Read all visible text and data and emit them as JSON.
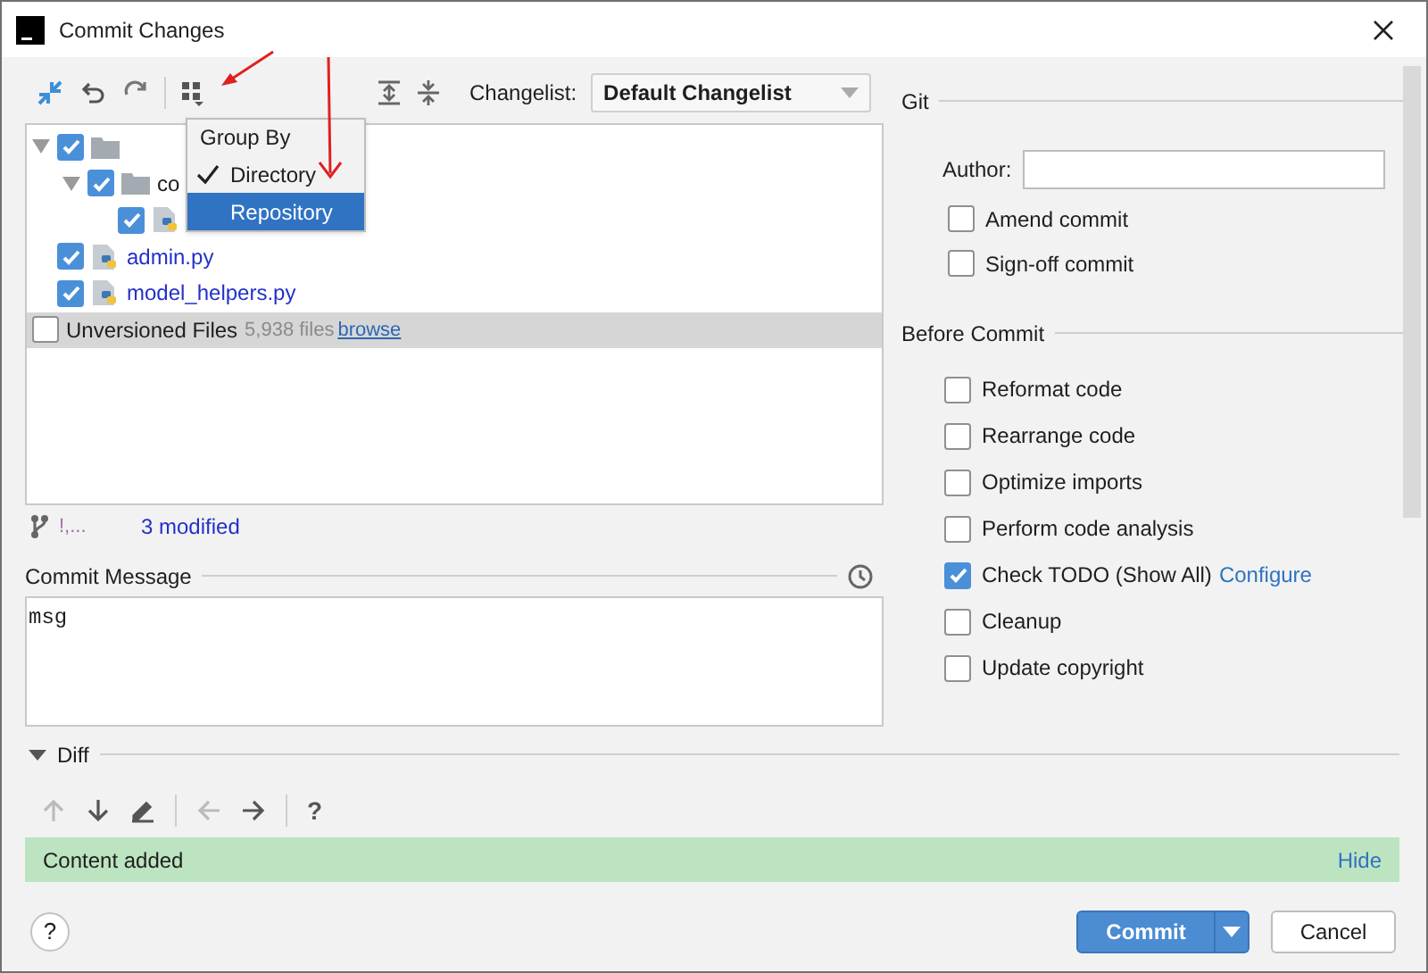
{
  "window": {
    "title": "Commit Changes"
  },
  "toolbar": {
    "changelist_label": "Changelist:",
    "changelist_value": "Default Changelist"
  },
  "group_by_menu": {
    "title": "Group By",
    "items": [
      {
        "label": "Directory",
        "checked": true,
        "selected": false
      },
      {
        "label": "Repository",
        "checked": false,
        "selected": true
      }
    ]
  },
  "tree": [
    {
      "kind": "folder",
      "checked": true,
      "expanded": true,
      "children": [
        {
          "kind": "folder",
          "label": "co",
          "checked": true,
          "expanded": true,
          "children": [
            {
              "kind": "file",
              "checked": true
            }
          ]
        }
      ]
    },
    {
      "kind": "file",
      "label": "admin.py",
      "checked": true
    },
    {
      "kind": "file",
      "label": "model_helpers.py",
      "checked": true
    },
    {
      "kind": "unversioned",
      "label": "Unversioned Files",
      "checked": false,
      "count": "5,938 files",
      "link": "browse"
    }
  ],
  "status": {
    "branch": "!,...",
    "modified": "3 modified"
  },
  "commit_message": {
    "label": "Commit Message",
    "value": "msg"
  },
  "git": {
    "title": "Git",
    "author_label": "Author:",
    "options": [
      {
        "label": "Amend commit",
        "checked": false
      },
      {
        "label": "Sign-off commit",
        "checked": false
      }
    ]
  },
  "before_commit": {
    "title": "Before Commit",
    "options": [
      {
        "label": "Reformat code",
        "checked": false
      },
      {
        "label": "Rearrange code",
        "checked": false
      },
      {
        "label": "Optimize imports",
        "checked": false
      },
      {
        "label": "Perform code analysis",
        "checked": false
      },
      {
        "label": "Check TODO (Show All)",
        "checked": true,
        "link": "Configure"
      },
      {
        "label": "Cleanup",
        "checked": false
      },
      {
        "label": "Update copyright",
        "checked": false
      }
    ]
  },
  "diff": {
    "title": "Diff",
    "notice": "Content added",
    "notice_link": "Hide",
    "help": "?"
  },
  "buttons": {
    "help": "?",
    "commit": "Commit",
    "cancel": "Cancel"
  }
}
